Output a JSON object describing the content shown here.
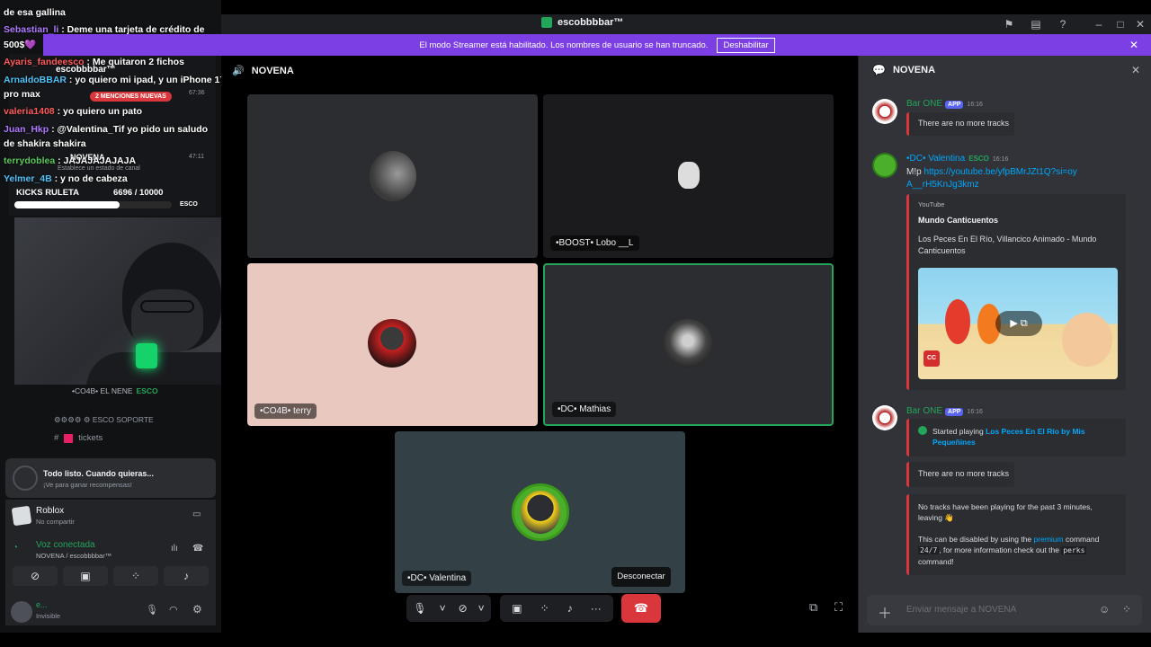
{
  "window": {
    "title": "escobbbbar™",
    "streamer_banner": "El modo Streamer está habilitado. Los nombres de usuario se han truncado.",
    "disable_label": "Deshabilitar"
  },
  "overlay_chat": [
    {
      "user": "",
      "text": "de esa gallina"
    },
    {
      "user": "Sebastian_li",
      "text": ": Deme una tarjeta de crédito de"
    },
    {
      "user": "",
      "text": "500$💜"
    },
    {
      "user": "Ayaris_fandeesco",
      "text": ": Me quitaron 2 fichos"
    },
    {
      "user": "ArnaldoBBAR",
      "text": ": yo quiero mi ipad, y un iPhone 17"
    },
    {
      "user": "",
      "text": "pro max"
    },
    {
      "user": "valeria1408",
      "text": ": yo quiero un pato"
    },
    {
      "user": "Juan_Hkp",
      "text": ": @Valentina_Tif yo pido un saludo"
    },
    {
      "user": "",
      "text": "de shakira shakira"
    },
    {
      "user": "terrydoblea",
      "text": ": JAJAJAJAJAJA"
    },
    {
      "user": "Yelmer_4B",
      "text": ": y no de cabeza"
    }
  ],
  "overlay_misc": {
    "server_name": "escobbbbar™",
    "mentions_badge": "2 MENCIONES NUEVAS",
    "time_1": "67:36",
    "time_2": "47:11",
    "channel_label": "NOVENA",
    "status_hint": "Establece un estado de canal",
    "kicks_title": "KICKS RULETA",
    "kicks_count": "6696 / 10000",
    "kicks_progress": 0.6696,
    "esco_tag": "ESCO"
  },
  "left_panel": {
    "member_under_cam": "•CO4B• EL NENE",
    "member_tag": "ESCO",
    "support_channel": "⚙⚙⚙⚙ ⚙ ESCO SOPORTE",
    "tickets_channel": "tickets",
    "activity_title": "Todo listo. Cuando quieras...",
    "activity_subtitle": "¡Ve para ganar recompensas!",
    "game_name": "Roblox",
    "game_status": "No compartir",
    "voice_status": "Voz conectada",
    "voice_channel": "NOVENA / escobbbbar™",
    "user_name": "e...",
    "user_status": "Invisible"
  },
  "stage": {
    "channel_title": "NOVENA",
    "tiles": [
      {
        "name": "",
        "bg": "#2c2d30"
      },
      {
        "name": "•BOOST• Lobo __L",
        "bg": "#1b1b1d"
      },
      {
        "name": "•CO4B• terry",
        "bg": "#e8c8bf"
      },
      {
        "name": "•DC• Mathias",
        "bg": "#2c2d30"
      },
      {
        "name": "•DC• Valentina",
        "bg": "#334046"
      }
    ],
    "disconnect_tooltip": "Desconectar"
  },
  "chat": {
    "channel": "NOVENA",
    "messages": [
      {
        "author": "Bar ONE",
        "badge": "APP",
        "time": "16:16",
        "embed": "There are no more tracks"
      },
      {
        "author": "•DC• Valentina",
        "tag": "ESCO",
        "time": "16:16",
        "text_prefix": "M!p",
        "link": "https://youtube.be/yfpBMrJZt1Q?si=oyA__rH5KnJg3kmz"
      },
      {
        "author": "Bar ONE",
        "badge": "APP",
        "time": "16:16"
      }
    ],
    "youtube_embed": {
      "provider": "YouTube",
      "channel": "Mundo Canticuentos",
      "title": "Los Peces En El Río, Villancico Animado - Mundo Canticuentos"
    },
    "started_playing_prefix": "Started playing",
    "started_playing_link": "Los Peces En El Río by Mis Pequeñines",
    "no_more_tracks": "There are no more tracks",
    "idle_msg": "No tracks have been playing for the past 3 minutes, leaving 👋",
    "disable_msg_1": "This can be disabled by using the",
    "premium_word": "premium",
    "disable_msg_2": "command",
    "code_24_7": "24/7",
    "disable_msg_3": ", for more information check out the",
    "code_perks": "perks",
    "disable_msg_4": "command!",
    "input_placeholder": "Enviar mensaje a NOVENA"
  },
  "colors": {
    "banner": "#7b3fe4",
    "speaking_outline": "#23a55a",
    "disconnect": "#da373c",
    "link": "#00a8fc"
  }
}
